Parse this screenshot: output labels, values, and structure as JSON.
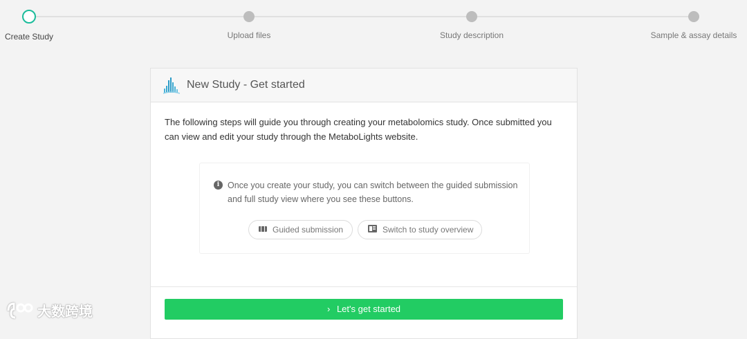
{
  "stepper": {
    "steps": [
      {
        "label": "Create Study",
        "active": true
      },
      {
        "label": "Upload files",
        "active": false
      },
      {
        "label": "Study description",
        "active": false
      },
      {
        "label": "Sample & assay details",
        "active": false
      }
    ]
  },
  "card": {
    "title": "New Study - Get started",
    "intro": "The following steps will guide you through creating your metabolomics study. Once submitted you can view and edit your study through the MetaboLights website.",
    "info": {
      "text": "Once you create your study, you can switch between the guided submission and full study view where you see these buttons.",
      "guided_label": "Guided submission",
      "overview_label": "Switch to study overview"
    },
    "start_label": "Let's get started"
  },
  "watermark": {
    "text": "大数跨境"
  },
  "colors": {
    "accent": "#1bbc9b",
    "start_button": "#22cc63",
    "step_inactive": "#bdbdbd"
  }
}
